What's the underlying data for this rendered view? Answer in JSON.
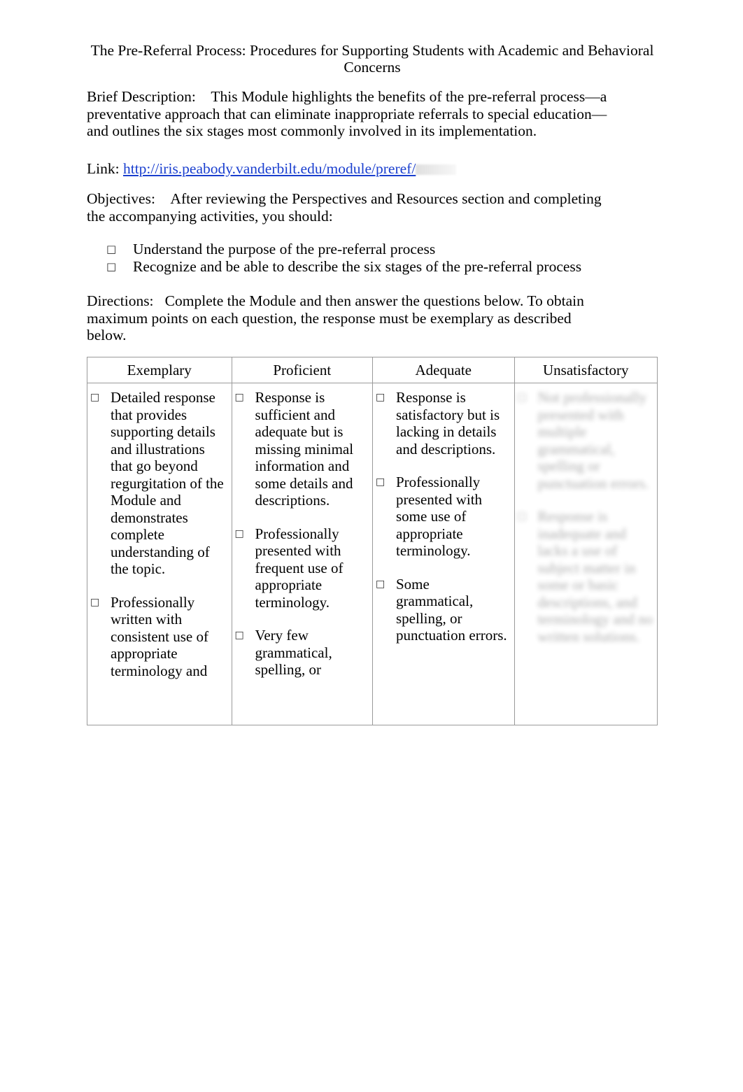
{
  "document": {
    "title": "The Pre-Referral Process: Procedures for Supporting Students with Academic and Behavioral Concerns",
    "brief_description_label": "Brief Description:",
    "brief_description_text": "This Module highlights the benefits of the pre-referral process—a preventative approach that can eliminate inappropriate referrals to special education—and outlines the six stages most commonly involved in its implementation.",
    "link_label": "Link:",
    "link_url": "http://iris.peabody.vanderbilt.edu/module/preref/",
    "objectives_label": "Objectives:",
    "objectives_text": "After reviewing the Perspectives and Resources section and completing the accompanying activities, you should:",
    "objectives_items": [
      "Understand the purpose of the pre-referral process",
      "Recognize and be able to describe the six stages of the pre-referral process"
    ],
    "directions_label": "Directions:",
    "directions_text": "Complete the Module and then answer the questions below. To obtain maximum points on each question, the response must be exemplary as described below.",
    "bullet_glyph": "□"
  },
  "rubric": {
    "columns": [
      {
        "header": "Exemplary",
        "items": [
          "Detailed response that provides supporting details and illustrations that go beyond regurgitation of the Module and demonstrates complete understanding of the topic.",
          "Professionally written with consistent use of appropriate terminology and"
        ]
      },
      {
        "header": "Proficient",
        "items": [
          "Response is sufficient and adequate but is missing minimal information and some details and descriptions.",
          "Professionally presented with frequent use of appropriate terminology.",
          "Very few grammatical, spelling, or"
        ]
      },
      {
        "header": "Adequate",
        "items": [
          "Response is satisfactory but is lacking in details and descriptions.",
          "Professionally presented with some use of appropriate terminology.",
          "Some grammatical, spelling, or punctuation errors."
        ]
      },
      {
        "header": "Unsatisfactory",
        "items": [
          "Not professionally presented with multiple grammatical, spelling or punctuation errors.",
          "Response is inadequate and lacks a use of subject matter in some or basic descriptions, and terminology and no written solutions."
        ]
      }
    ]
  }
}
